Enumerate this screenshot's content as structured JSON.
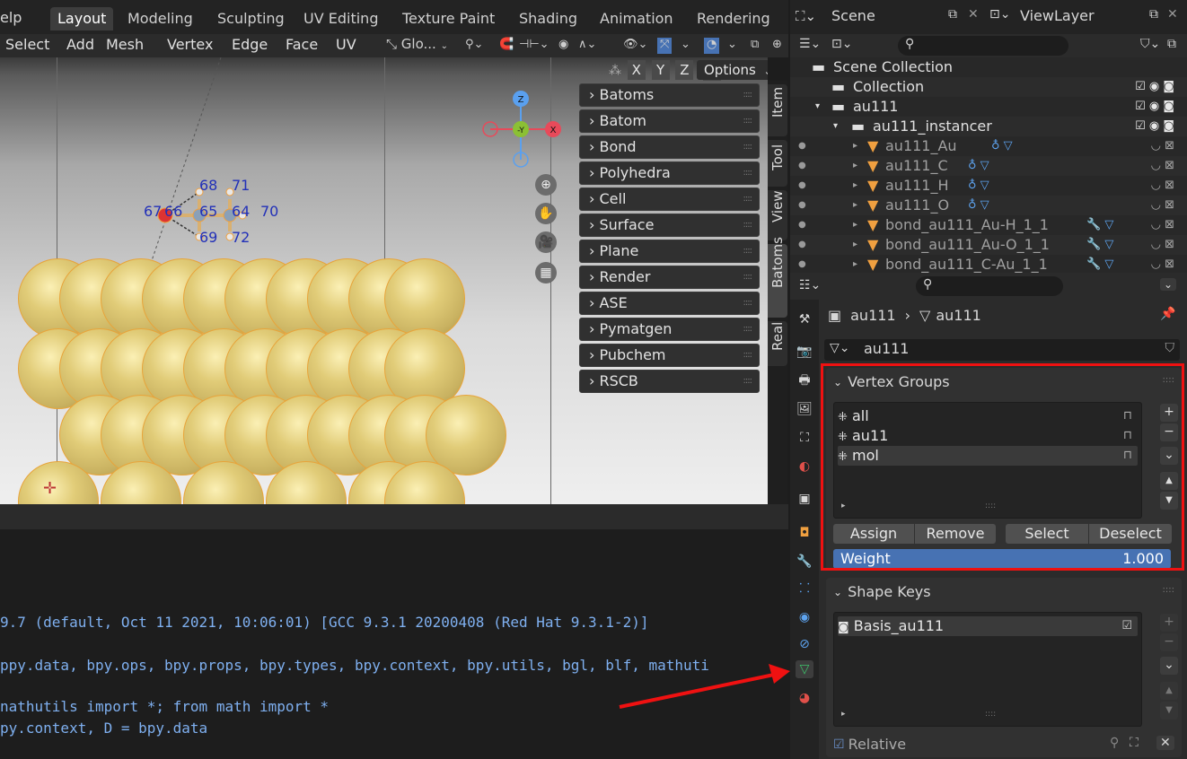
{
  "topbar": {
    "help_fragment": "elp",
    "workspaces": [
      "Layout",
      "Modeling",
      "Sculpting",
      "UV Editing",
      "Texture Paint",
      "Shading",
      "Animation",
      "Rendering"
    ],
    "active_workspace": "Layout"
  },
  "viewport_header": {
    "menus": [
      "Select",
      "Add",
      "Mesh",
      "Vertex",
      "Edge",
      "Face",
      "UV"
    ],
    "transform_orientation": "Glo...",
    "axes": [
      "X",
      "Y",
      "Z"
    ],
    "options_label": "Options"
  },
  "gizmo": {
    "z": "Z",
    "y": "-Y",
    "x": "X"
  },
  "atom_labels": [
    "68",
    "71",
    "67",
    "66",
    "65",
    "64",
    "70",
    "69",
    "72"
  ],
  "batoms_panels": [
    "Batoms",
    "Batom",
    "Bond",
    "Polyhedra",
    "Cell",
    "Surface",
    "Plane",
    "Render",
    "ASE",
    "Pymatgen",
    "Pubchem",
    "RSCB"
  ],
  "sidebar_tabs": [
    "Item",
    "Tool",
    "View",
    "Batoms",
    "Real"
  ],
  "active_sidebar_tab": "Batoms",
  "console": {
    "lines": [
      "9.7 (default, Oct 11 2021, 10:06:01)  [GCC 9.3.1 20200408 (Red Hat 9.3.1-2)]",
      "ppy.data, bpy.ops, bpy.props, bpy.types, bpy.context, bpy.utils, bgl, blf, mathuti",
      "nathutils import *; from math import *",
      "py.context, D = bpy.data"
    ]
  },
  "outliner": {
    "scene": "Scene",
    "view_layer": "ViewLayer",
    "rows": [
      {
        "label": "Scene Collection"
      },
      {
        "label": "Collection"
      },
      {
        "label": "au111"
      },
      {
        "label": "au111_instancer"
      },
      {
        "label": "au111_Au"
      },
      {
        "label": "au111_C"
      },
      {
        "label": "au111_H"
      },
      {
        "label": "au111_O"
      },
      {
        "label": "bond_au111_Au-H_1_1"
      },
      {
        "label": "bond_au111_Au-O_1_1"
      },
      {
        "label": "bond_au111_C-Au_1_1"
      }
    ]
  },
  "properties": {
    "breadcrumb_object": "au111",
    "breadcrumb_data": "au111",
    "data_name": "au111",
    "vertex_groups": {
      "title": "Vertex Groups",
      "items": [
        "all",
        "au11",
        "mol"
      ],
      "selected": "mol",
      "buttons": [
        "Assign",
        "Remove",
        "Select",
        "Deselect"
      ],
      "weight_label": "Weight",
      "weight_value": "1.000"
    },
    "shape_keys": {
      "title": "Shape Keys",
      "items": [
        "Basis_au111"
      ],
      "relative_label": "Relative"
    }
  },
  "colors": {
    "highlight": "#ef1111",
    "weight_bar": "#4772b3",
    "atom_gold": "#d8c26e",
    "label_blue": "#2230b8"
  }
}
